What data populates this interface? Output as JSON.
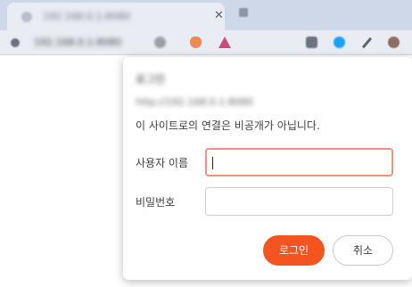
{
  "browser": {
    "tab_title": "192.168.0.1:8080",
    "tab_close_glyph": "✕",
    "url": "192.168.0.1:8080",
    "icons": [
      "favicon-icon",
      "new-tab-icon",
      "site-info-icon",
      "share-icon",
      "brave-shields-icon",
      "brave-rewards-icon",
      "extension-icon",
      "bird-extension-icon",
      "puzzle-icon",
      "profile-icon"
    ],
    "colors": {
      "accent": "#f4541f",
      "tab_strip": "#cfd8e8",
      "toolbar": "#e9edf3"
    }
  },
  "auth_dialog": {
    "title": "로그인",
    "origin": "http://192.168.0.1:8080",
    "warning": "이 사이트로의 연결은 비공개가 아닙니다.",
    "username_label": "사용자 이름",
    "username_value": "",
    "password_label": "비밀번호",
    "password_value": "",
    "login_button": "로그인",
    "cancel_button": "취소"
  }
}
